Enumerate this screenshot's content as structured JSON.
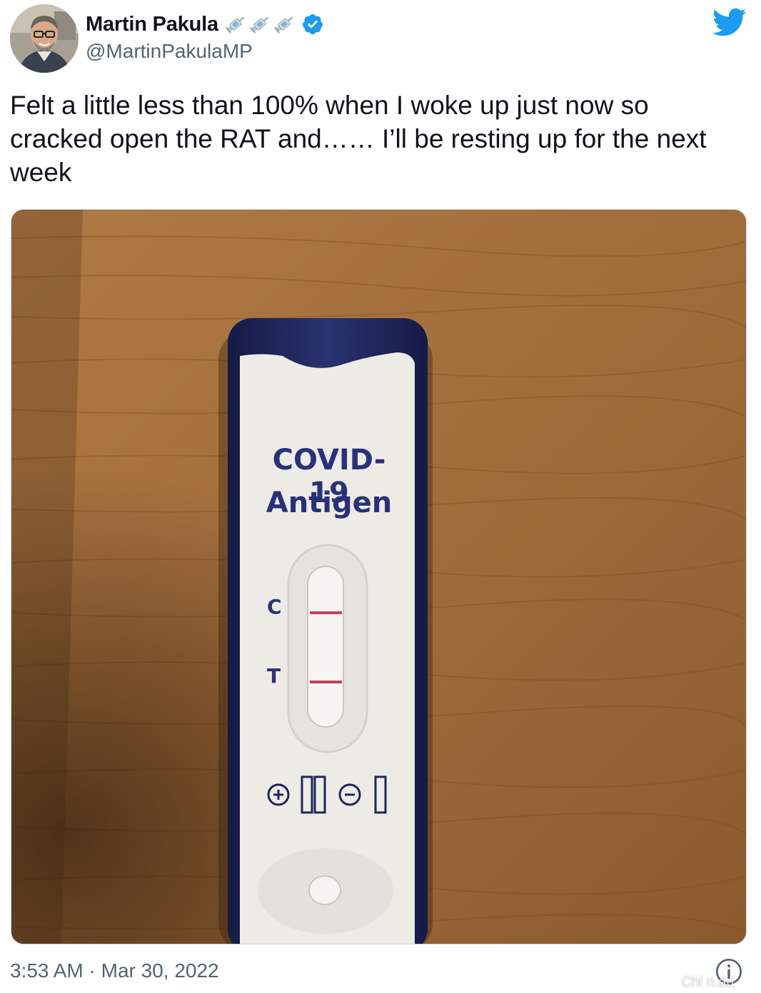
{
  "tweet": {
    "author": {
      "name": "Martin Pakula",
      "handle": "@MartinPakulaMP",
      "name_emojis": [
        "syringe-icon",
        "syringe-icon",
        "syringe-icon"
      ],
      "verified": true
    },
    "text": "Felt a little less than 100% when I woke up just now so cracked open the RAT and…… I’ll be resting up for the next week",
    "media": {
      "test_label_line1": "COVID-19",
      "test_label_line2": "Antigen",
      "control_marker": "C",
      "test_marker": "T"
    },
    "timestamp": "3:53 AM · Mar 30, 2022"
  },
  "watermark": "Chi n.au",
  "colors": {
    "twitter_blue": "#1d9bf0",
    "secondary_text": "#536471",
    "test_casing": "#1f2657",
    "result_line": "#c8405a"
  }
}
